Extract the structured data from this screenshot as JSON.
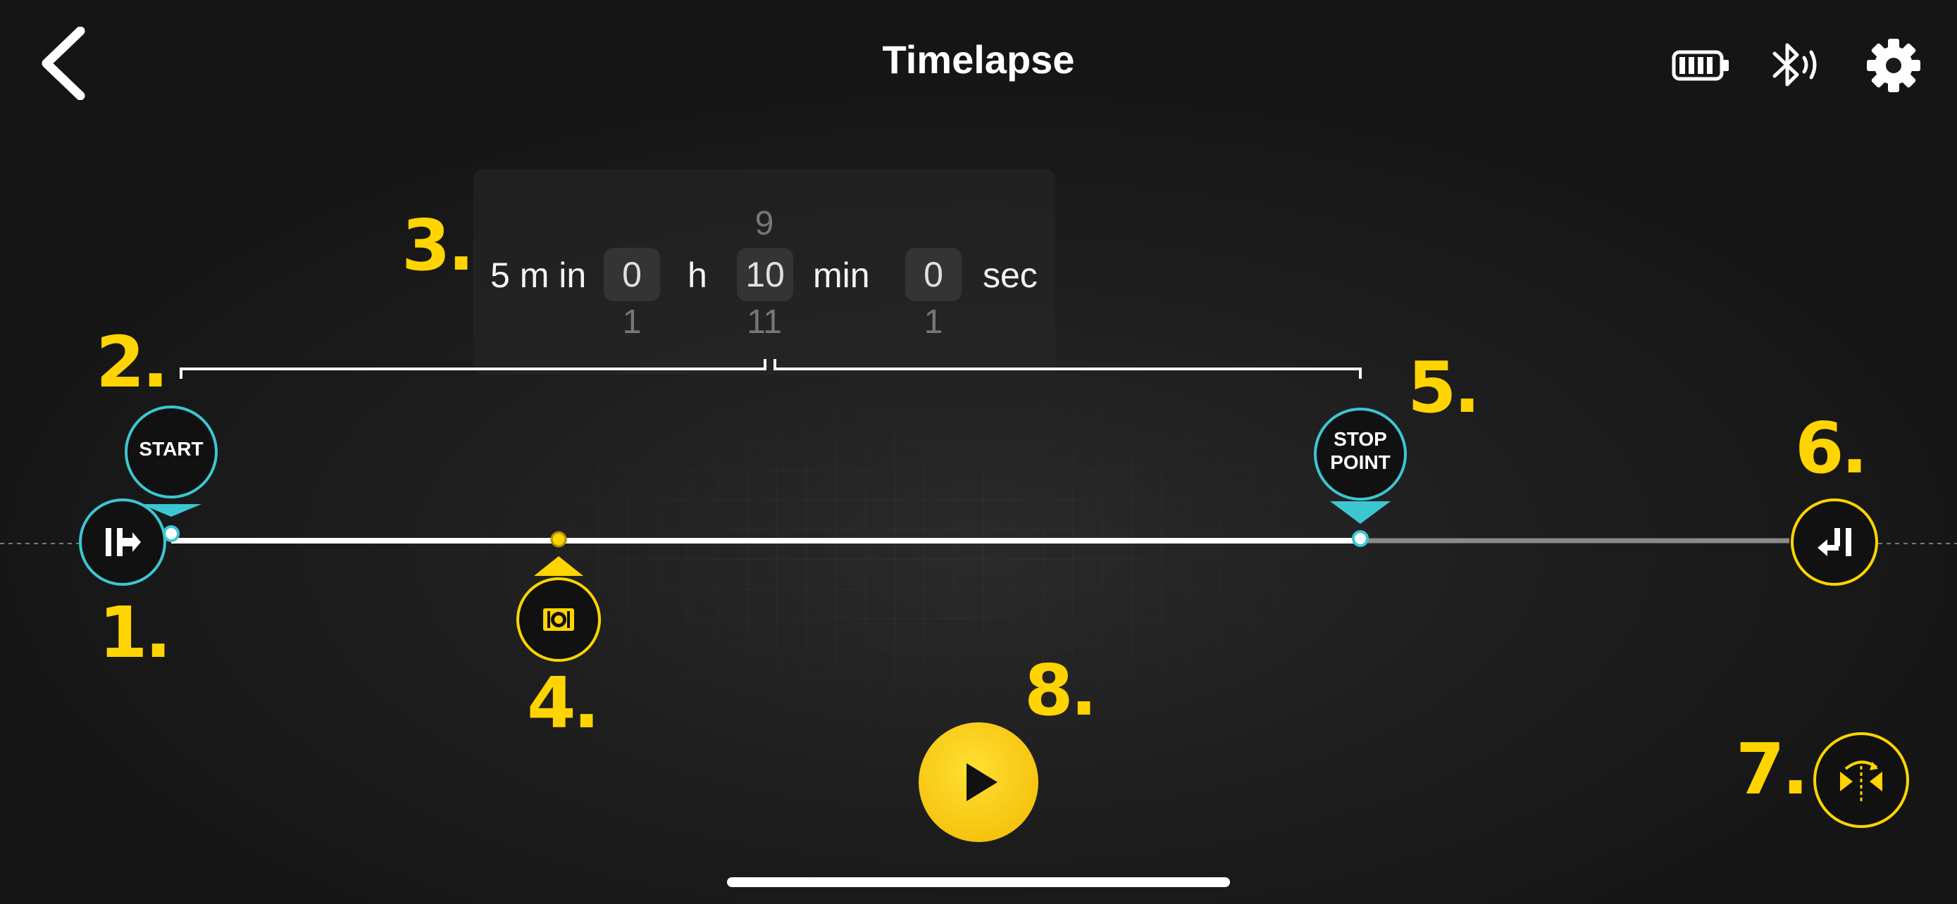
{
  "header": {
    "title": "Timelapse",
    "back_icon": "chevron-left-icon",
    "battery_icon": "battery-icon",
    "bluetooth_icon": "bluetooth-icon",
    "settings_icon": "gear-icon"
  },
  "duration_picker": {
    "prefix": "5 m in",
    "hours": {
      "prev": "",
      "value": "0",
      "next": "1",
      "unit": "h"
    },
    "minutes": {
      "prev": "9",
      "value": "10",
      "next": "11",
      "unit": "min"
    },
    "seconds": {
      "prev": "",
      "value": "0",
      "next": "1",
      "unit": "sec"
    }
  },
  "timeline": {
    "start_label": "START",
    "stop_label_line1": "STOP",
    "stop_label_line2": "POINT",
    "start_button_icon": "go-to-start-icon",
    "keyframe_icon": "camera-keyframe-icon",
    "end_button_icon": "go-to-end-icon"
  },
  "controls": {
    "play_icon": "play-icon",
    "mirror_icon": "flip-direction-icon"
  },
  "callouts": [
    "1.",
    "2.",
    "3.",
    "4.",
    "5.",
    "6.",
    "7.",
    "8."
  ],
  "colors": {
    "accent_yellow": "#ffd400",
    "accent_cyan": "#3cc6d2",
    "background": "#1a1a1a"
  }
}
